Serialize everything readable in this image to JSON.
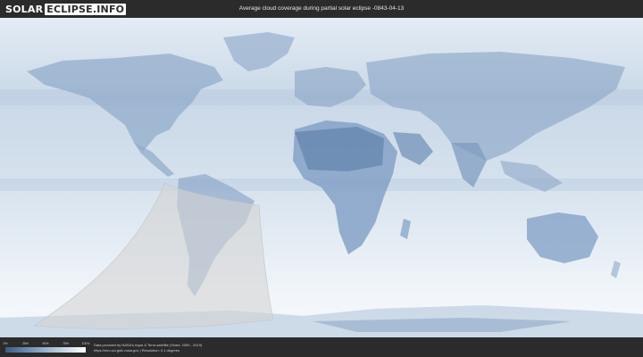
{
  "header": {
    "logo_part1": "SOLAR",
    "logo_part2": "ECLIPSE.INFO",
    "title": "Average cloud coverage during partial solar eclipse -0843-04-13"
  },
  "legend": {
    "ticks": [
      "0%",
      "25%",
      "50%",
      "75%",
      "100%"
    ],
    "low_color": "#3a5c85",
    "high_color": "#ffffff"
  },
  "credits": {
    "line1": "Data provided by NASA's Aqua & Terra satellite (Years: 2000 - 2019)",
    "line2": "https://neo.sci.gsfc.nasa.gov | Resolution: 0.1 degrees"
  },
  "map": {
    "ocean_color": "#d9e4ef",
    "land_color": "#7f9cc1",
    "eclipse_region_color": "#d3d3d3"
  }
}
